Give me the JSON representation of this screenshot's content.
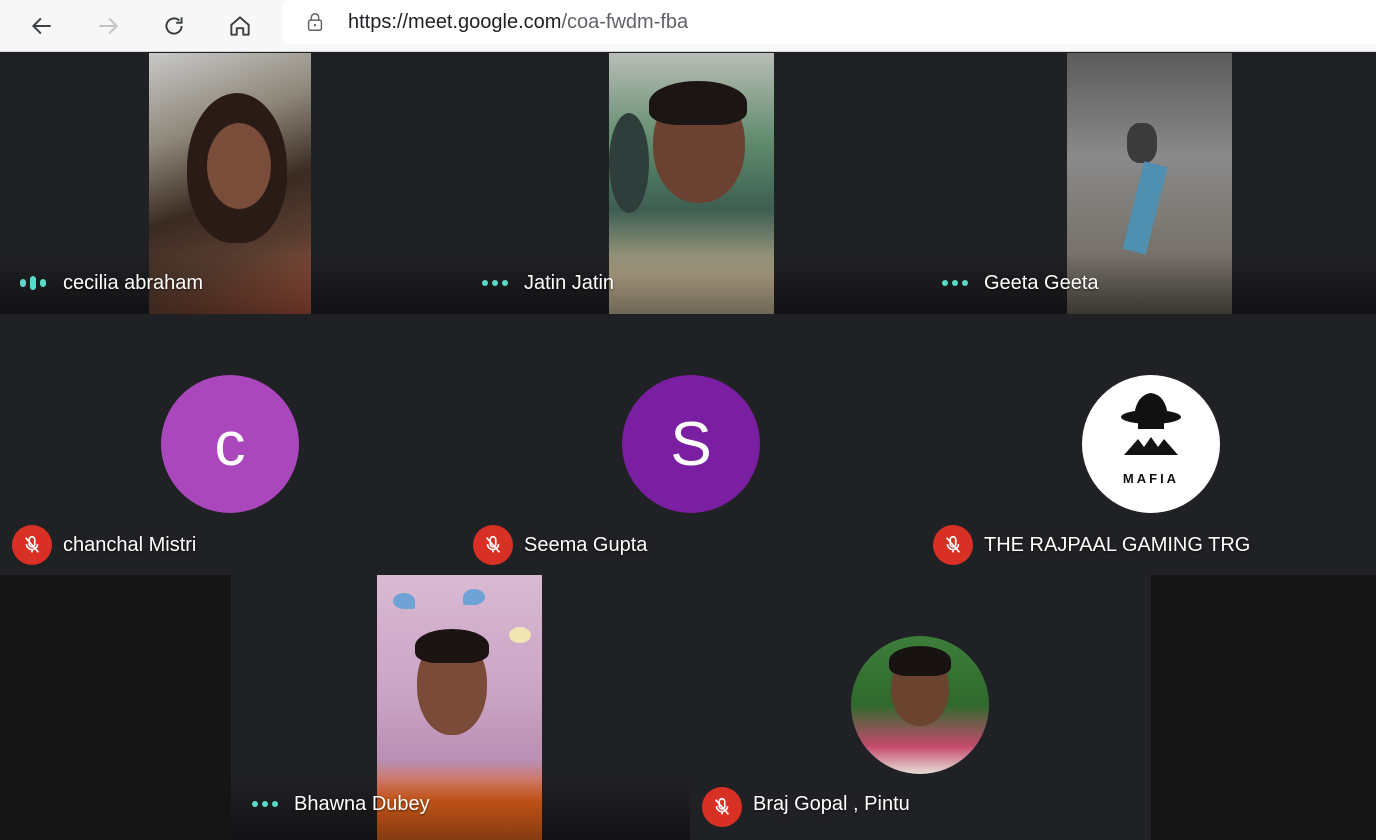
{
  "browser": {
    "url_host": "https://meet.google.com",
    "url_path": "/coa-fwdm-fba",
    "icons": [
      "back-arrow-icon",
      "forward-arrow-icon",
      "reload-icon",
      "home-icon",
      "lock-icon"
    ]
  },
  "colors": {
    "meet_bg": "#202124",
    "speaking_indicator": "#5bd9c8",
    "muted_badge": "#d93025",
    "avatar_c": "#ab47bc",
    "avatar_s": "#7b1fa2"
  },
  "participants": [
    {
      "name": "cecilia abraham",
      "status": "speaking"
    },
    {
      "name": "Jatin Jatin",
      "status": "idle"
    },
    {
      "name": "Geeta Geeta",
      "status": "idle"
    },
    {
      "name": "chanchal Mistri",
      "status": "muted",
      "avatar_letter": "c"
    },
    {
      "name": "Seema Gupta",
      "status": "muted",
      "avatar_letter": "S"
    },
    {
      "name": "THE RAJPAAL GAMING TRG",
      "status": "muted",
      "avatar_logo_text": "MAFIA"
    },
    {
      "name": "Bhawna Dubey",
      "status": "idle"
    },
    {
      "name": "Braj Gopal , Pintu",
      "status": "muted"
    }
  ]
}
